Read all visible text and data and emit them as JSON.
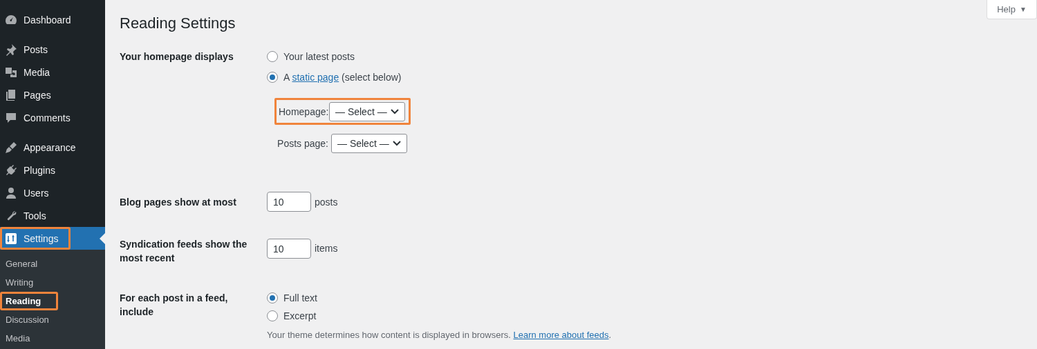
{
  "sidebar": {
    "groups": [
      {
        "items": [
          {
            "label": "Dashboard",
            "selected": false,
            "highlighted": false
          }
        ]
      },
      {
        "items": [
          {
            "label": "Posts",
            "selected": false,
            "highlighted": false
          },
          {
            "label": "Media",
            "selected": false,
            "highlighted": false
          },
          {
            "label": "Pages",
            "selected": false,
            "highlighted": false
          },
          {
            "label": "Comments",
            "selected": false,
            "highlighted": false
          }
        ]
      },
      {
        "items": [
          {
            "label": "Appearance",
            "selected": false,
            "highlighted": false
          },
          {
            "label": "Plugins",
            "selected": false,
            "highlighted": false
          },
          {
            "label": "Users",
            "selected": false,
            "highlighted": false
          },
          {
            "label": "Tools",
            "selected": false,
            "highlighted": false
          },
          {
            "label": "Settings",
            "selected": true,
            "highlighted": true,
            "children": [
              {
                "label": "General",
                "selected": false,
                "highlighted": false
              },
              {
                "label": "Writing",
                "selected": false,
                "highlighted": false
              },
              {
                "label": "Reading",
                "selected": true,
                "highlighted": true
              },
              {
                "label": "Discussion",
                "selected": false,
                "highlighted": false
              },
              {
                "label": "Media",
                "selected": false,
                "highlighted": false
              }
            ]
          }
        ]
      }
    ]
  },
  "help_button": {
    "label": "Help",
    "caret": "▼"
  },
  "page_title": "Reading Settings",
  "homepage_displays": {
    "label": "Your homepage displays",
    "options": [
      {
        "kind": "plain",
        "label": "Your latest posts",
        "selected": false
      },
      {
        "kind": "link",
        "prefix": "A",
        "link": "static page",
        "suffix": "(select below)",
        "selected": true
      }
    ],
    "selects": [
      {
        "label": "Homepage:",
        "value": "— Select —",
        "highlighted": true
      },
      {
        "label": "Posts page:",
        "value": "— Select —",
        "highlighted": false
      }
    ]
  },
  "blog_pages": {
    "label": "Blog pages show at most",
    "value": "10",
    "unit": "posts"
  },
  "syndication": {
    "label": "Syndication feeds show the most recent",
    "value": "10",
    "unit": "items"
  },
  "feed_content": {
    "label": "For each post in a feed, include",
    "options": [
      {
        "label": "Full text",
        "selected": true
      },
      {
        "label": "Excerpt",
        "selected": false
      }
    ],
    "description": "Your theme determines how content is displayed in browsers.",
    "link": "Learn more about feeds",
    "after_link": "."
  }
}
